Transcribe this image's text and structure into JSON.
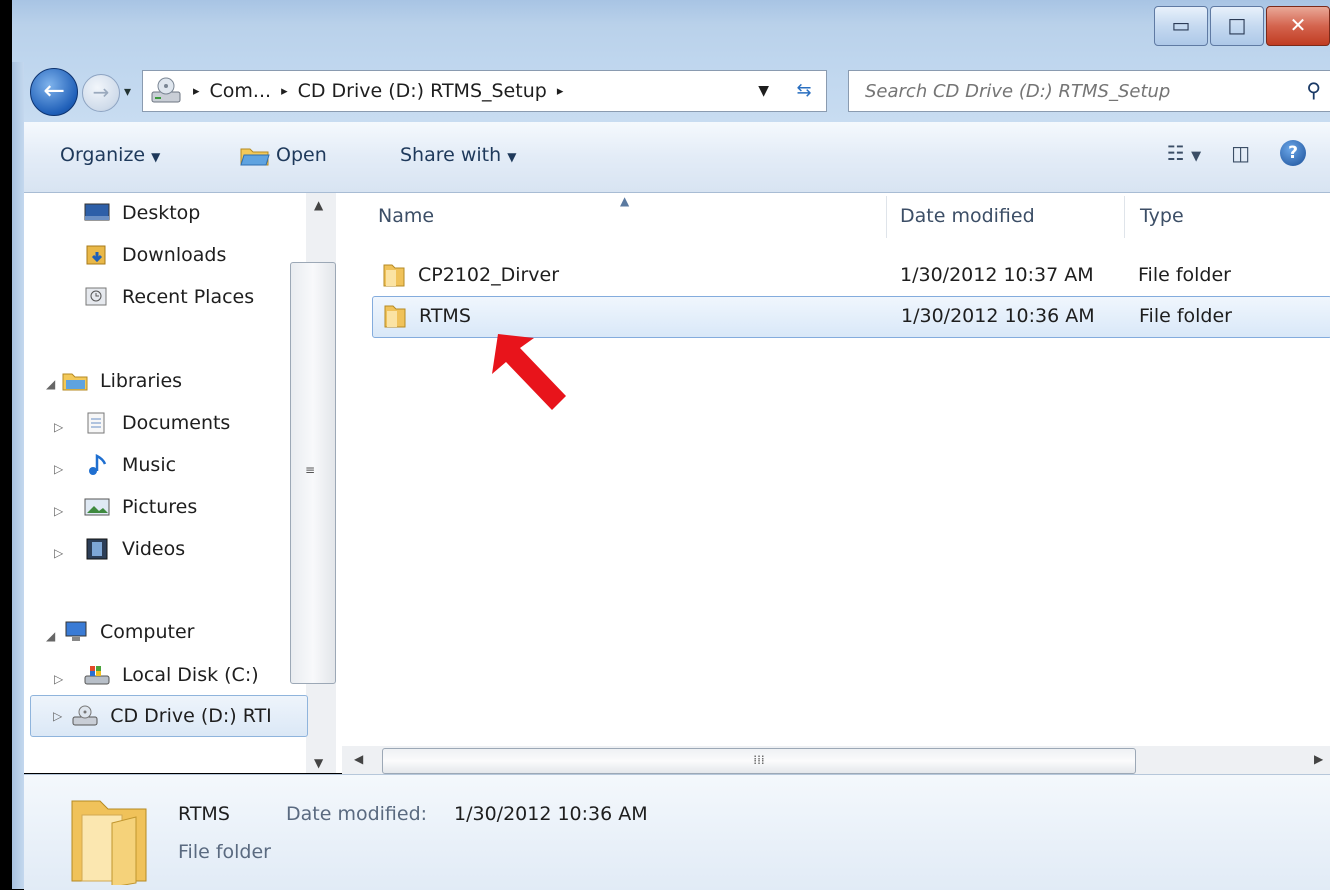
{
  "window": {
    "caption_buttons": {
      "minimize": "▭",
      "maximize": "□",
      "close": "✕"
    }
  },
  "address_bar": {
    "crumbs": [
      "Com...",
      "CD Drive (D:) RTMS_Setup"
    ],
    "separator": "▸"
  },
  "search": {
    "placeholder": "Search CD Drive (D:) RTMS_Setup"
  },
  "toolbar": {
    "organize": "Organize",
    "open": "Open",
    "share_with": "Share with"
  },
  "nav_pane": {
    "favorites": [
      {
        "label": "Desktop",
        "icon": "desktop-icon"
      },
      {
        "label": "Downloads",
        "icon": "downloads-icon"
      },
      {
        "label": "Recent Places",
        "icon": "recent-places-icon"
      }
    ],
    "libraries": {
      "label": "Libraries",
      "items": [
        "Documents",
        "Music",
        "Pictures",
        "Videos"
      ]
    },
    "computer": {
      "label": "Computer",
      "items": [
        "Local Disk (C:)",
        "CD Drive (D:) RTI"
      ]
    }
  },
  "file_list": {
    "columns": [
      "Name",
      "Date modified",
      "Type"
    ],
    "rows": [
      {
        "name": "CP2102_Dirver",
        "date": "1/30/2012 10:37 AM",
        "type": "File folder"
      },
      {
        "name": "RTMS",
        "date": "1/30/2012 10:36 AM",
        "type": "File folder"
      }
    ],
    "selected_index": 1
  },
  "details": {
    "name": "RTMS",
    "date_label": "Date modified:",
    "date_value": "1/30/2012 10:36 AM",
    "type": "File folder"
  },
  "annotation": {
    "color": "#e8141b"
  }
}
